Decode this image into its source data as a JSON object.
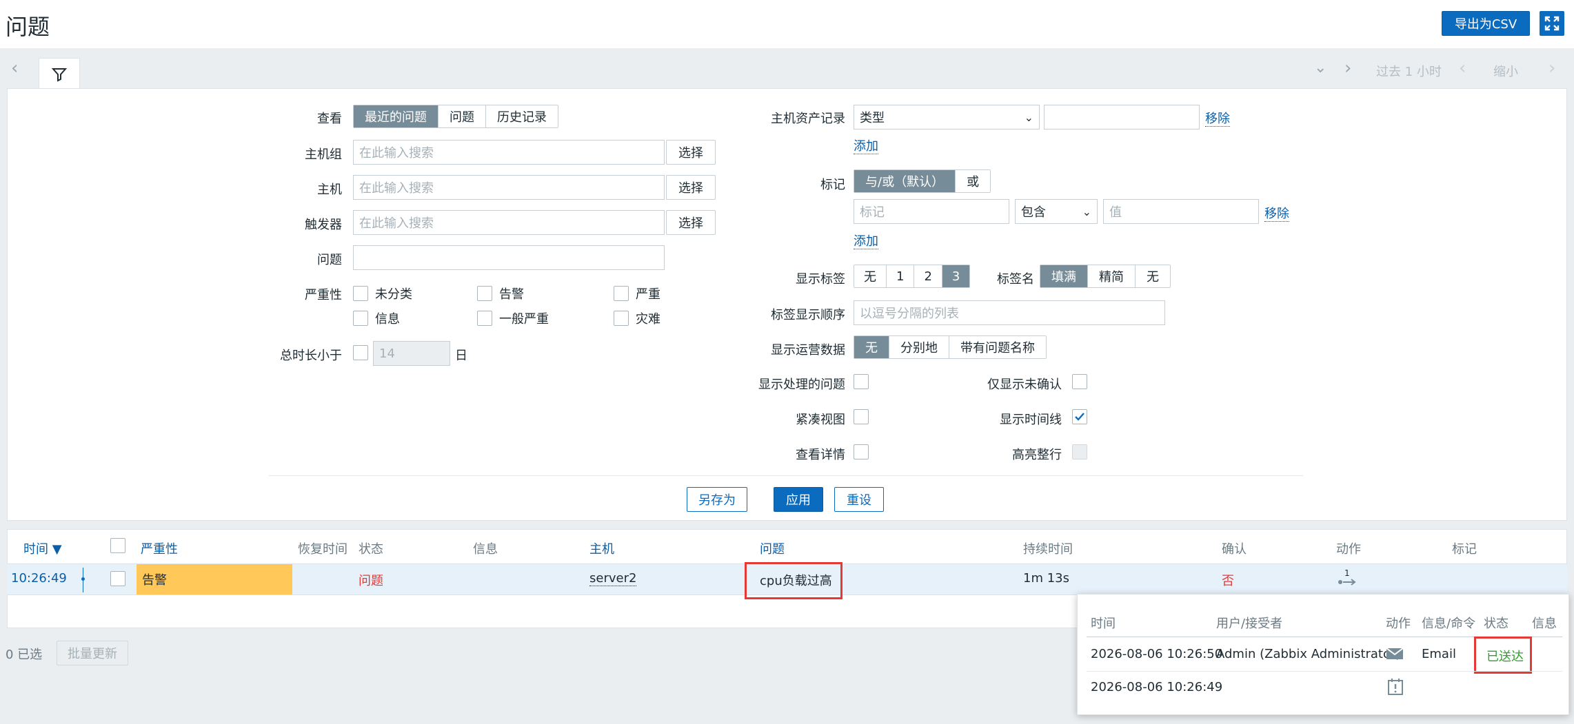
{
  "page": {
    "title": "问题",
    "export_label": "导出为CSV"
  },
  "timebar": {
    "range_label": "过去 1 小时",
    "zoom_out_label": "缩小"
  },
  "filter": {
    "left": {
      "view_label": "查看",
      "view_options": [
        "最近的问题",
        "问题",
        "历史记录"
      ],
      "host_groups_label": "主机组",
      "hosts_label": "主机",
      "triggers_label": "触发器",
      "search_placeholder": "在此输入搜索",
      "select_label": "选择",
      "problem_label": "问题",
      "severity_label": "严重性",
      "severities": [
        "未分类",
        "告警",
        "严重",
        "信息",
        "一般严重",
        "灾难"
      ],
      "age_label": "总时长小于",
      "age_value": "14",
      "age_unit": "日"
    },
    "right": {
      "inventory_label": "主机资产记录",
      "inventory_type": "类型",
      "remove_label": "移除",
      "add_label": "添加",
      "tags_label": "标记",
      "tags_operator": [
        "与/或（默认）",
        "或"
      ],
      "tag_placeholder": "标记",
      "tag_operator_value": "包含",
      "value_placeholder": "值",
      "show_tags_label": "显示标签",
      "show_tags_options": [
        "无",
        "1",
        "2",
        "3"
      ],
      "tag_name_label": "标签名",
      "tag_name_options": [
        "填满",
        "精简",
        "无"
      ],
      "tag_priority_label": "标签显示顺序",
      "tag_priority_placeholder": "以逗号分隔的列表",
      "opdata_label": "显示运营数据",
      "opdata_options": [
        "无",
        "分别地",
        "带有问题名称"
      ],
      "show_suppressed_label": "显示处理的问题",
      "unack_label": "仅显示未确认",
      "compact_label": "紧凑视图",
      "timeline_label": "显示时间线",
      "details_label": "查看详情",
      "highlight_label": "高亮整行"
    },
    "buttons": {
      "save_as": "另存为",
      "apply": "应用",
      "reset": "重设"
    }
  },
  "table": {
    "headers": {
      "time": "时间 ▼",
      "severity": "严重性",
      "recovery": "恢复时间",
      "status": "状态",
      "info": "信息",
      "host": "主机",
      "problem": "问题",
      "duration": "持续时间",
      "ack": "确认",
      "actions": "动作",
      "tags": "标记"
    },
    "rows": [
      {
        "time": "10:26:49",
        "severity": "告警",
        "status": "问题",
        "host": "server2",
        "problem": "cpu负载过高",
        "duration": "1m 13s",
        "ack": "否",
        "actions_count": "1"
      }
    ],
    "colors": {
      "warning": "#ffc859",
      "problem_red": "#e53935",
      "ok_green": "#2e9e2e"
    }
  },
  "footer": {
    "selected": "0 已选",
    "mass_update": "批量更新"
  },
  "popup": {
    "headers": {
      "time": "时间",
      "user": "用户/接受者",
      "action": "动作",
      "message": "信息/命令",
      "status": "状态",
      "info": "信息"
    },
    "rows": [
      {
        "time": "2026-08-06 10:26:50",
        "user": "Admin (Zabbix Administrator)",
        "action_icon": "envelope-icon",
        "message": "Email",
        "status": "已送达"
      },
      {
        "time": "2026-08-06 10:26:49",
        "action_icon": "calendar-alert-icon"
      }
    ]
  }
}
